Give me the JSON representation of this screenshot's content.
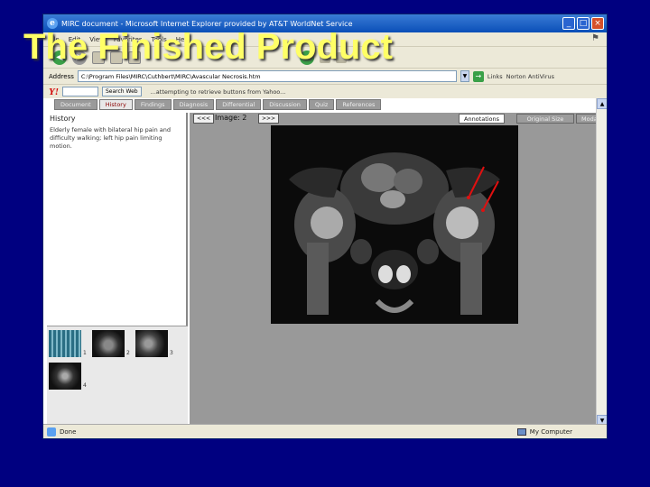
{
  "slide": {
    "title": "The Finished Product"
  },
  "window": {
    "title": "MIRC document - Microsoft Internet Explorer provided by AT&T WorldNet Service",
    "icon_glyph": "e",
    "controls": {
      "minimize": "_",
      "maximize": "□",
      "close": "×"
    }
  },
  "menu": {
    "items": [
      "File",
      "Edit",
      "View",
      "Favorites",
      "Tools",
      "Help"
    ]
  },
  "address": {
    "label": "Address",
    "value": "C:\\Program Files\\MIRC\\Cuthbert\\MIRC\\Avascular Necrosis.htm",
    "go_glyph": "→",
    "links": "Links",
    "norton": "Norton AntiVirus"
  },
  "yahoo": {
    "logo": "Y!",
    "search_button": "Search Web",
    "status": "...attempting to retrieve buttons from Yahoo..."
  },
  "tabs": [
    {
      "label": "Document",
      "active": false
    },
    {
      "label": "History",
      "active": true
    },
    {
      "label": "Findings",
      "active": false
    },
    {
      "label": "Diagnosis",
      "active": false
    },
    {
      "label": "Differential",
      "active": false
    },
    {
      "label": "Discussion",
      "active": false
    },
    {
      "label": "Quiz",
      "active": false
    },
    {
      "label": "References",
      "active": false
    }
  ],
  "history": {
    "heading": "History",
    "text": "Elderly female with bilateral hip pain and difficulty walking; left hip pain limiting motion."
  },
  "thumbnails": {
    "numbers": [
      "1",
      "2",
      "3",
      "4"
    ]
  },
  "viewer": {
    "prev": "<<<",
    "next": ">>>",
    "image_label": "Image: 2",
    "annotations": "Annotations",
    "original_size": "Original Size",
    "modality_image": "Modality Image"
  },
  "statusbar": {
    "status": "Done",
    "zone": "My Computer"
  },
  "colors": {
    "desktop": "#000080",
    "title_text": "#ffff66",
    "arrow_red": "#e01010"
  }
}
